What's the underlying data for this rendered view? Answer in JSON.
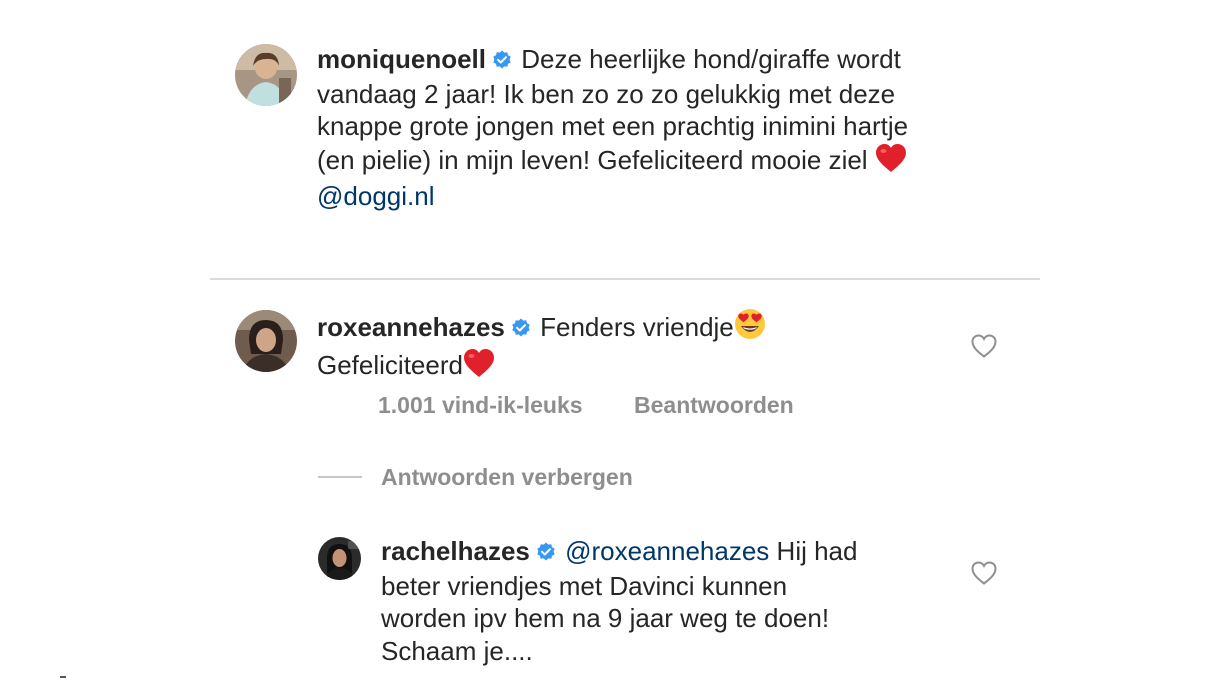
{
  "caption": {
    "username": "moniquenoell",
    "text_1": "Deze heerlijke hond/giraffe wordt",
    "text_2": "vandaag 2 jaar! Ik ben zo zo zo gelukkig met deze",
    "text_3": "knappe grote jongen met een prachtig inimini hartje",
    "text_4": "(en pielie) in mijn leven! Gefeliciteerd mooie ziel",
    "mention": "@doggi.nl",
    "emoji": "red-heart"
  },
  "comment": {
    "username": "roxeannehazes",
    "text_1": "Fenders vriendje",
    "emoji_1": "heart-eyes",
    "text_2": "Gefeliciteerd",
    "emoji_2": "red-heart",
    "likes": "1.001 vind-ik-leuks",
    "reply_label": "Beantwoorden",
    "hide_replies_label": "Antwoorden verbergen"
  },
  "reply": {
    "username": "rachelhazes",
    "mention": "@roxeannehazes",
    "text_1": "Hij had",
    "text_2": "beter vriendjes met Davinci kunnen",
    "text_3": "worden ipv hem na 9 jaar weg te doen!",
    "text_4": "Schaam je...."
  },
  "colors": {
    "text": "#262626",
    "secondary": "#8e8e8e",
    "mention": "#00376b",
    "verified": "#3897f0",
    "heart_emoji": "#e0202b",
    "divider": "#dbdbdb"
  }
}
